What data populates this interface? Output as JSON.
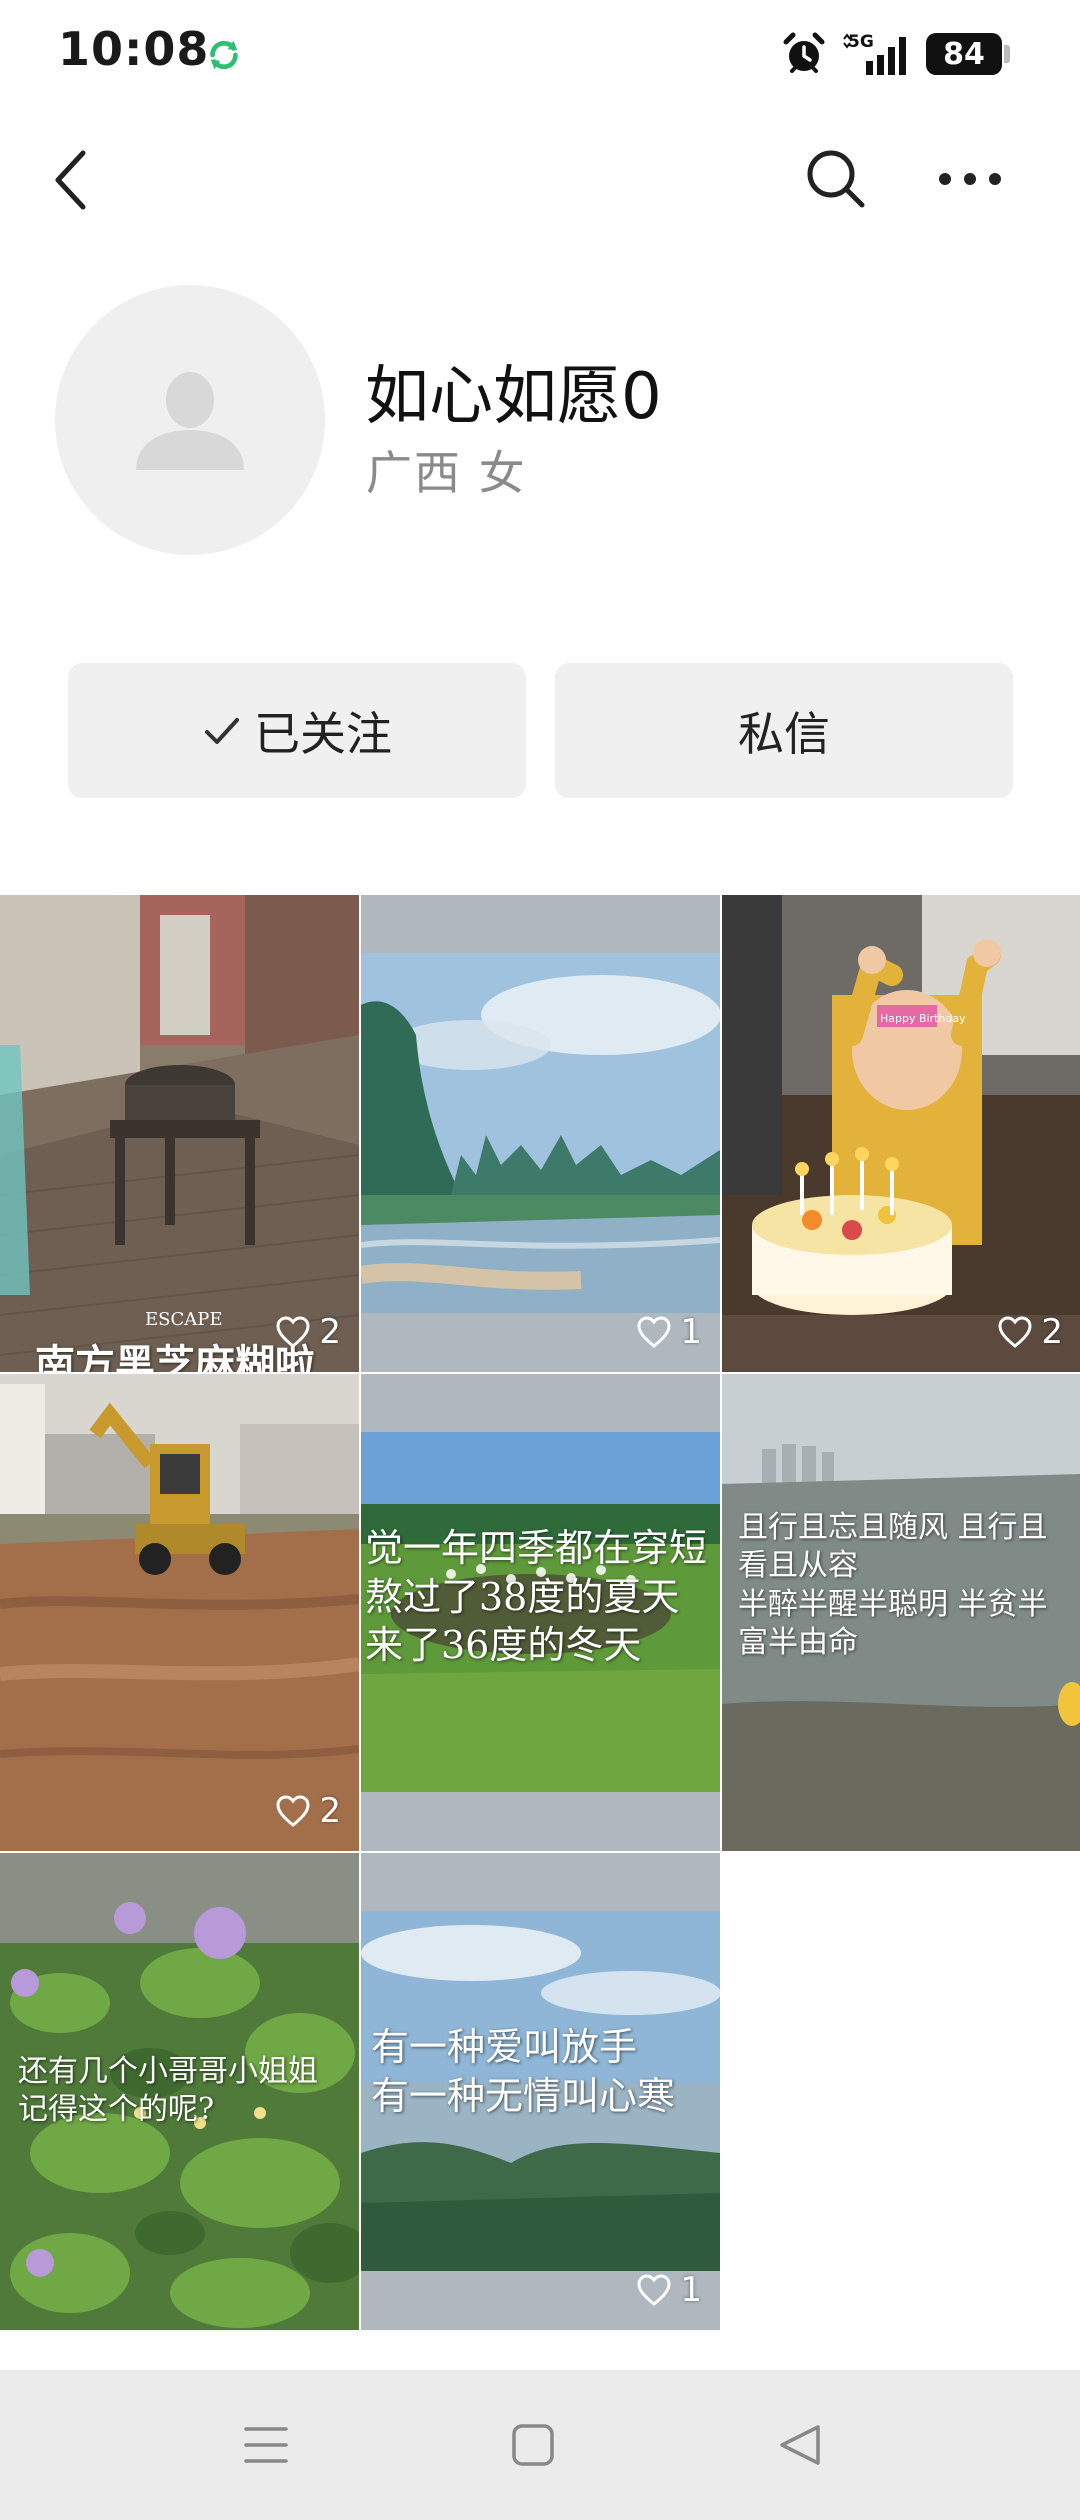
{
  "status_bar": {
    "time": "10:08",
    "network_label": "5G",
    "battery": "84"
  },
  "nav": {
    "back_icon": "chevron-left-icon",
    "search_icon": "search-icon",
    "more_icon": "more-horizontal-icon"
  },
  "profile": {
    "name": "如心如愿0",
    "meta": "广西 女",
    "avatar_icon": "default-avatar-icon"
  },
  "actions": {
    "follow_label": "已关注",
    "message_label": "私信"
  },
  "posts": [
    {
      "caption": "南方黑芝麻糊啦",
      "watermark": "ESCAPE",
      "likes": "2"
    },
    {
      "caption": "",
      "likes": "1"
    },
    {
      "caption": "",
      "cake_text": "Happy Birthday",
      "likes": "2"
    },
    {
      "caption": "",
      "likes": "2"
    },
    {
      "caption": "觉一年四季都在穿短\n熬过了38度的夏天\n来了36度的冬天",
      "likes": ""
    },
    {
      "caption": "且行且忘且随风 且行且\n看且从容\n半醉半醒半聪明 半贫半\n富半由命",
      "likes": ""
    },
    {
      "caption": "还有几个小哥哥小姐姐\n记得这个的呢?",
      "likes": ""
    },
    {
      "caption": "有一种爱叫放手\n有一种无情叫心寒",
      "likes": "1"
    }
  ],
  "colors": {
    "button_bg": "#f0f0f0",
    "meta_text": "#8a8a8a",
    "status_app_green": "#2fbf71"
  }
}
